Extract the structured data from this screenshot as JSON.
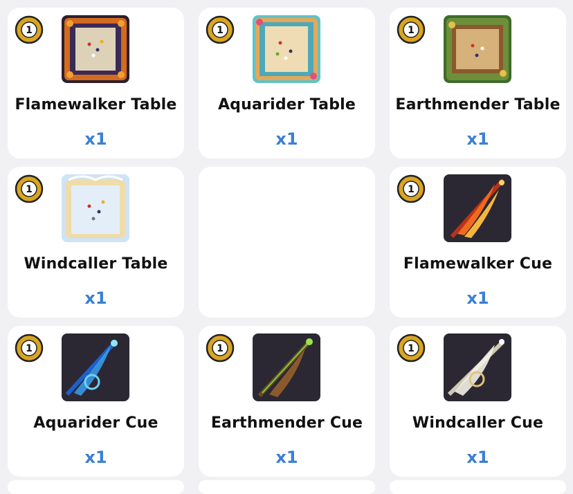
{
  "badge_value": "1",
  "colors": {
    "qty": "#3a7fd6",
    "background": "#f1f1f3"
  },
  "items": [
    {
      "name": "Flamewalker Table",
      "qty": "x1",
      "type": "table",
      "theme": "flame"
    },
    {
      "name": "Aquarider Table",
      "qty": "x1",
      "type": "table",
      "theme": "aqua"
    },
    {
      "name": "Earthmender Table",
      "qty": "x1",
      "type": "table",
      "theme": "earth"
    },
    {
      "name": "Windcaller Table",
      "qty": "x1",
      "type": "table",
      "theme": "wind"
    },
    {
      "name": "",
      "qty": "",
      "type": "empty",
      "theme": ""
    },
    {
      "name": "Flamewalker Cue",
      "qty": "x1",
      "type": "cue",
      "theme": "flame"
    },
    {
      "name": "Aquarider Cue",
      "qty": "x1",
      "type": "cue",
      "theme": "aqua"
    },
    {
      "name": "Earthmender Cue",
      "qty": "x1",
      "type": "cue",
      "theme": "earth"
    },
    {
      "name": "Windcaller Cue",
      "qty": "x1",
      "type": "cue",
      "theme": "wind"
    }
  ]
}
